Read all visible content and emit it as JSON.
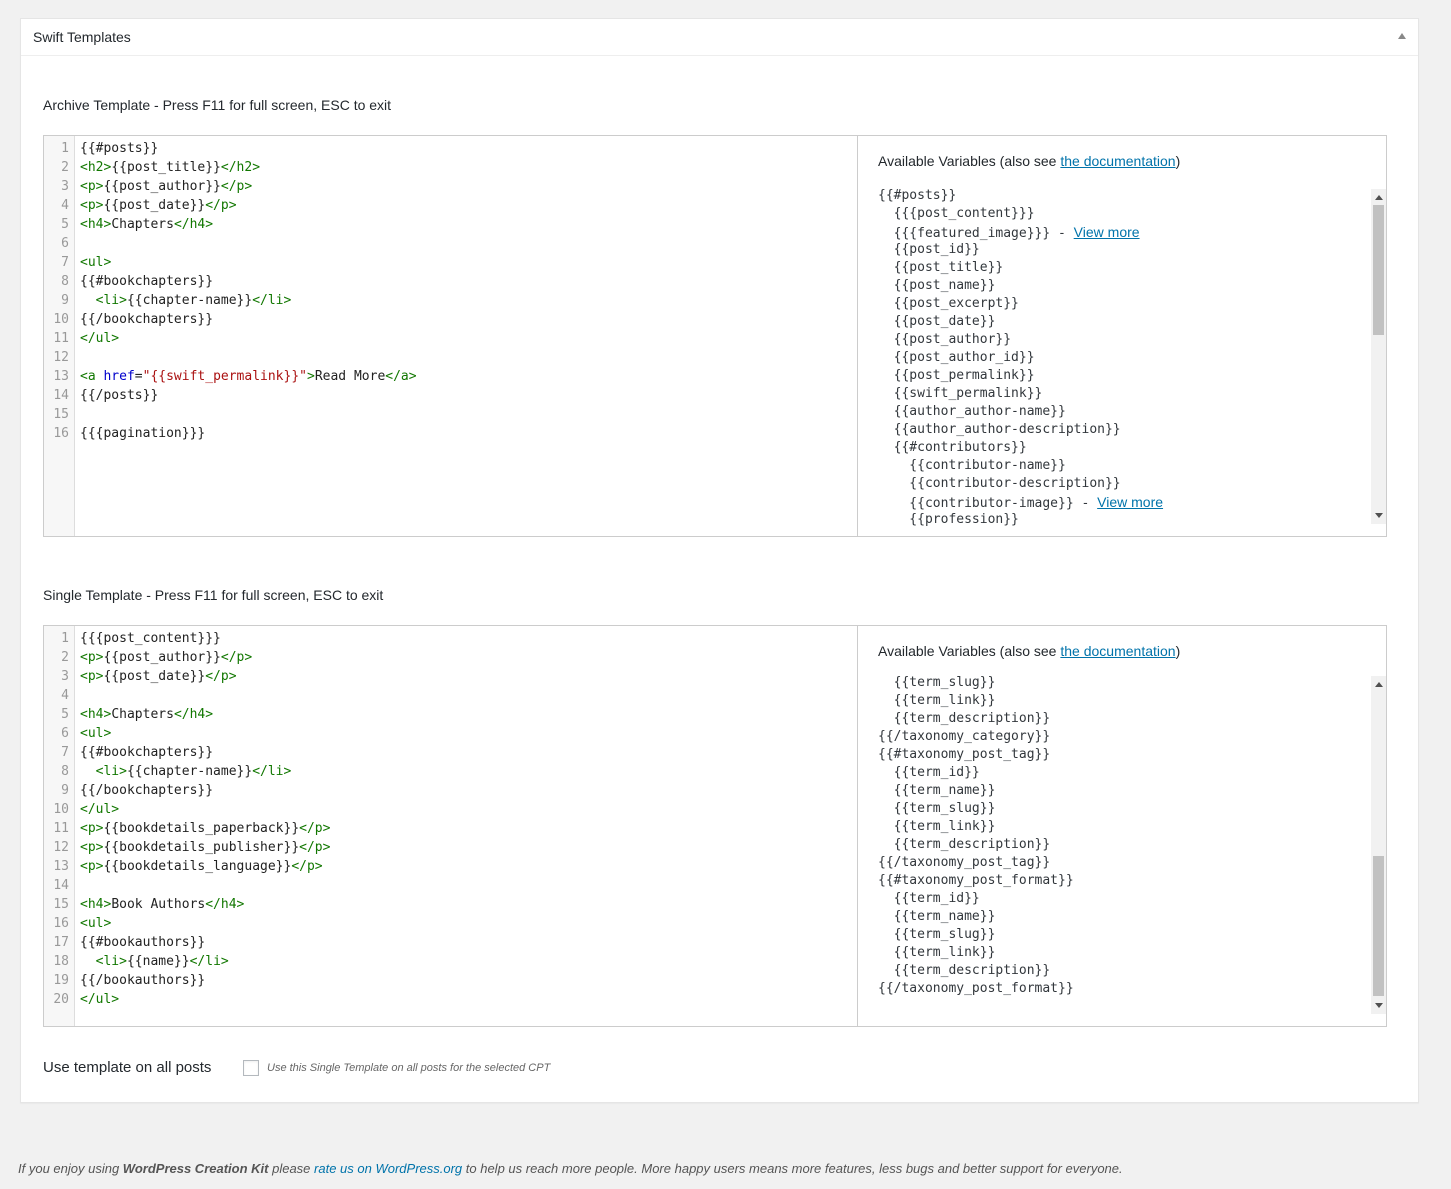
{
  "metabox": {
    "title": "Swift Templates"
  },
  "archive": {
    "label": "Archive Template - Press F11 for full screen, ESC to exit",
    "code": [
      {
        "n": "1",
        "html": "{{#posts}}"
      },
      {
        "n": "2",
        "html": "<span class=\"tag\">&lt;h2&gt;</span>{{post_title}}<span class=\"tag\">&lt;/h2&gt;</span>"
      },
      {
        "n": "3",
        "html": "<span class=\"tag\">&lt;p&gt;</span>{{post_author}}<span class=\"tag\">&lt;/p&gt;</span>"
      },
      {
        "n": "4",
        "html": "<span class=\"tag\">&lt;p&gt;</span>{{post_date}}<span class=\"tag\">&lt;/p&gt;</span>"
      },
      {
        "n": "5",
        "html": "<span class=\"tag\">&lt;h4&gt;</span>Chapters<span class=\"tag\">&lt;/h4&gt;</span>"
      },
      {
        "n": "6",
        "html": ""
      },
      {
        "n": "7",
        "html": "<span class=\"tag\">&lt;ul&gt;</span>"
      },
      {
        "n": "8",
        "html": "{{#bookchapters}}"
      },
      {
        "n": "9",
        "html": "  <span class=\"tag\">&lt;li&gt;</span>{{chapter-name}}<span class=\"tag\">&lt;/li&gt;</span>"
      },
      {
        "n": "10",
        "html": "{{/bookchapters}}"
      },
      {
        "n": "11",
        "html": "<span class=\"tag\">&lt;/ul&gt;</span>"
      },
      {
        "n": "12",
        "html": ""
      },
      {
        "n": "13",
        "html": "<span class=\"tag\">&lt;a</span> <span class=\"attr\">href</span>=<span class=\"str\">\"{{swift_permalink}}\"</span><span class=\"tag\">&gt;</span>Read More<span class=\"tag\">&lt;/a&gt;</span>"
      },
      {
        "n": "14",
        "html": "{{/posts}}"
      },
      {
        "n": "15",
        "html": ""
      },
      {
        "n": "16",
        "html": "{{{pagination}}}"
      }
    ],
    "vars_title_prefix": "Available Variables (also see ",
    "vars_title_link": "the documentation",
    "vars_title_suffix": ")",
    "vars": [
      {
        "text": "{{#posts}}"
      },
      {
        "text": "  {{{post_content}}}"
      },
      {
        "text": "  {{{featured_image}}} - ",
        "link": "View more"
      },
      {
        "text": "  {{post_id}}"
      },
      {
        "text": "  {{post_title}}"
      },
      {
        "text": "  {{post_name}}"
      },
      {
        "text": "  {{post_excerpt}}"
      },
      {
        "text": "  {{post_date}}"
      },
      {
        "text": "  {{post_author}}"
      },
      {
        "text": "  {{post_author_id}}"
      },
      {
        "text": "  {{post_permalink}}"
      },
      {
        "text": "  {{swift_permalink}}"
      },
      {
        "text": "  {{author_author-name}}"
      },
      {
        "text": "  {{author_author-description}}"
      },
      {
        "text": "  {{#contributors}}"
      },
      {
        "text": "    {{contributor-name}}"
      },
      {
        "text": "    {{contributor-description}}"
      },
      {
        "text": "    {{contributor-image}} - ",
        "link": "View more"
      },
      {
        "text": "    {{profession}}"
      }
    ]
  },
  "single": {
    "label": "Single Template - Press F11 for full screen, ESC to exit",
    "code": [
      {
        "n": "1",
        "html": "{{{post_content}}}"
      },
      {
        "n": "2",
        "html": "<span class=\"tag\">&lt;p&gt;</span>{{post_author}}<span class=\"tag\">&lt;/p&gt;</span>"
      },
      {
        "n": "3",
        "html": "<span class=\"tag\">&lt;p&gt;</span>{{post_date}}<span class=\"tag\">&lt;/p&gt;</span>"
      },
      {
        "n": "4",
        "html": ""
      },
      {
        "n": "5",
        "html": "<span class=\"tag\">&lt;h4&gt;</span>Chapters<span class=\"tag\">&lt;/h4&gt;</span>"
      },
      {
        "n": "6",
        "html": "<span class=\"tag\">&lt;ul&gt;</span>"
      },
      {
        "n": "7",
        "html": "{{#bookchapters}}"
      },
      {
        "n": "8",
        "html": "  <span class=\"tag\">&lt;li&gt;</span>{{chapter-name}}<span class=\"tag\">&lt;/li&gt;</span>"
      },
      {
        "n": "9",
        "html": "{{/bookchapters}}"
      },
      {
        "n": "10",
        "html": "<span class=\"tag\">&lt;/ul&gt;</span>"
      },
      {
        "n": "11",
        "html": "<span class=\"tag\">&lt;p&gt;</span>{{bookdetails_paperback}}<span class=\"tag\">&lt;/p&gt;</span>"
      },
      {
        "n": "12",
        "html": "<span class=\"tag\">&lt;p&gt;</span>{{bookdetails_publisher}}<span class=\"tag\">&lt;/p&gt;</span>"
      },
      {
        "n": "13",
        "html": "<span class=\"tag\">&lt;p&gt;</span>{{bookdetails_language}}<span class=\"tag\">&lt;/p&gt;</span>"
      },
      {
        "n": "14",
        "html": ""
      },
      {
        "n": "15",
        "html": "<span class=\"tag\">&lt;h4&gt;</span>Book Authors<span class=\"tag\">&lt;/h4&gt;</span>"
      },
      {
        "n": "16",
        "html": "<span class=\"tag\">&lt;ul&gt;</span>"
      },
      {
        "n": "17",
        "html": "{{#bookauthors}}"
      },
      {
        "n": "18",
        "html": "  <span class=\"tag\">&lt;li&gt;</span>{{name}}<span class=\"tag\">&lt;/li&gt;</span>"
      },
      {
        "n": "19",
        "html": "{{/bookauthors}}"
      },
      {
        "n": "20",
        "html": "<span class=\"tag\">&lt;/ul&gt;</span>"
      }
    ],
    "vars_title_prefix": "Available Variables (also see ",
    "vars_title_link": "the documentation",
    "vars_title_suffix": ")",
    "vars": [
      {
        "text": "  {{term_slug}}"
      },
      {
        "text": "  {{term_link}}"
      },
      {
        "text": "  {{term_description}}"
      },
      {
        "text": "{{/taxonomy_category}}"
      },
      {
        "text": "{{#taxonomy_post_tag}}"
      },
      {
        "text": "  {{term_id}}"
      },
      {
        "text": "  {{term_name}}"
      },
      {
        "text": "  {{term_slug}}"
      },
      {
        "text": "  {{term_link}}"
      },
      {
        "text": "  {{term_description}}"
      },
      {
        "text": "{{/taxonomy_post_tag}}"
      },
      {
        "text": "{{#taxonomy_post_format}}"
      },
      {
        "text": "  {{term_id}}"
      },
      {
        "text": "  {{term_name}}"
      },
      {
        "text": "  {{term_slug}}"
      },
      {
        "text": "  {{term_link}}"
      },
      {
        "text": "  {{term_description}}"
      },
      {
        "text": "{{/taxonomy_post_format}}"
      }
    ]
  },
  "option": {
    "label": "Use template on all posts",
    "checked": false,
    "description": "Use this Single Template on all posts for the selected CPT"
  },
  "footer": {
    "prefix": "If you enjoy using ",
    "brand": "WordPress Creation Kit",
    "mid": " please ",
    "link": "rate us on WordPress.org",
    "suffix": " to help us reach more people. More happy users means more features, less bugs and better support for everyone."
  },
  "colors": {
    "link": "#0073aa",
    "tag": "#117700",
    "attr": "#0000cc",
    "string": "#aa1111"
  }
}
